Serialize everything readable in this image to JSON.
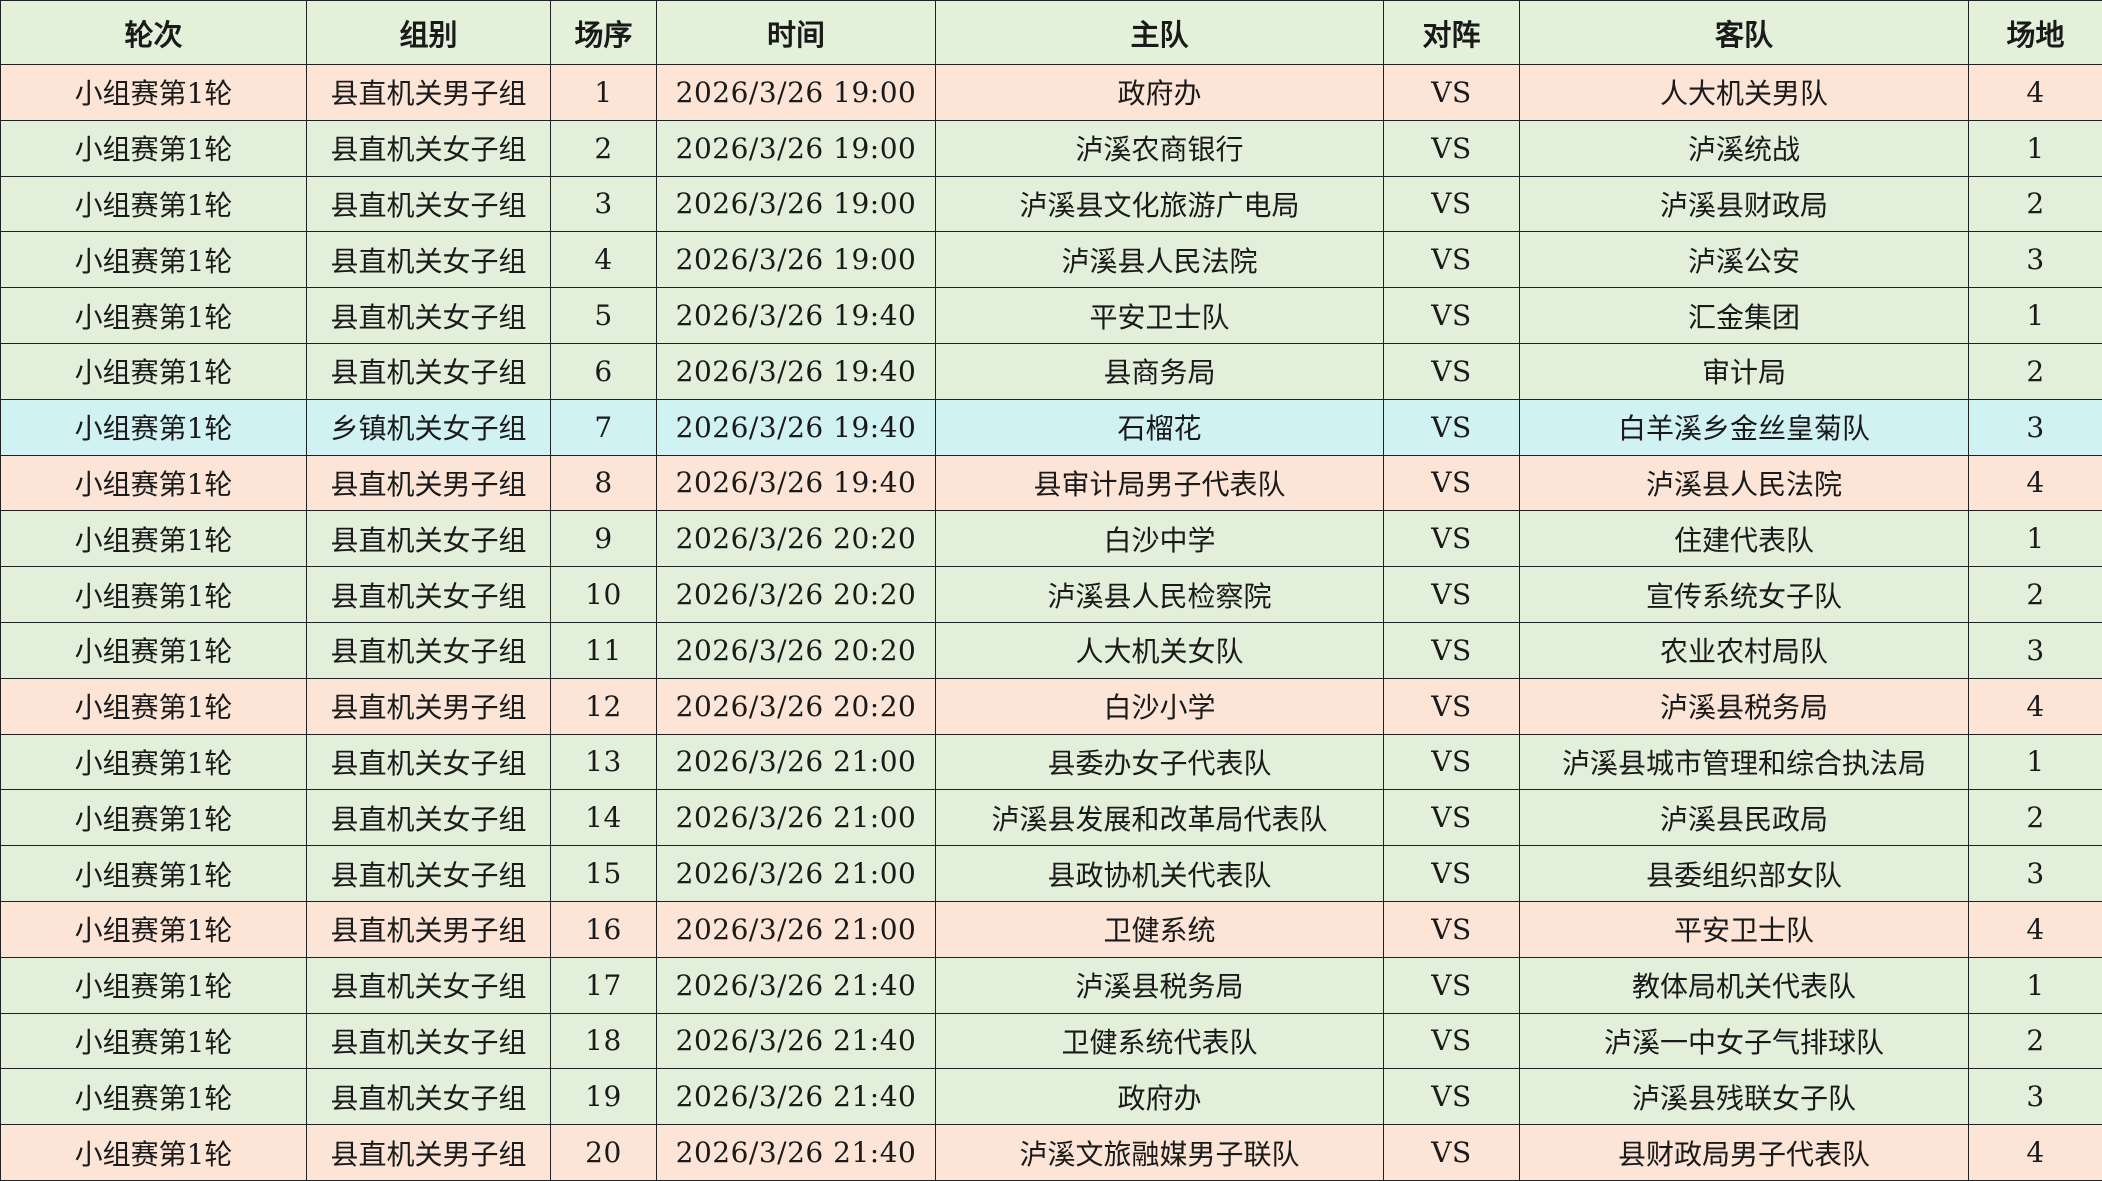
{
  "headers": [
    "轮次",
    "组别",
    "场序",
    "时间",
    "主队",
    "对阵",
    "客队",
    "场地"
  ],
  "group_colors": {
    "县直机关男子组": "#fce4d6",
    "县直机关女子组": "#e2efda",
    "乡镇机关女子组": "#d1f2f2",
    "header": "#e3f0da"
  },
  "rows": [
    {
      "round": "小组赛第1轮",
      "group": "县直机关男子组",
      "seq": "1",
      "time": "2026/3/26 19:00",
      "home": "政府办",
      "vs": "VS",
      "away": "人大机关男队",
      "venue": "4"
    },
    {
      "round": "小组赛第1轮",
      "group": "县直机关女子组",
      "seq": "2",
      "time": "2026/3/26 19:00",
      "home": "泸溪农商银行",
      "vs": "VS",
      "away": "泸溪统战",
      "venue": "1"
    },
    {
      "round": "小组赛第1轮",
      "group": "县直机关女子组",
      "seq": "3",
      "time": "2026/3/26 19:00",
      "home": "泸溪县文化旅游广电局",
      "vs": "VS",
      "away": "泸溪县财政局",
      "venue": "2"
    },
    {
      "round": "小组赛第1轮",
      "group": "县直机关女子组",
      "seq": "4",
      "time": "2026/3/26 19:00",
      "home": "泸溪县人民法院",
      "vs": "VS",
      "away": "泸溪公安",
      "venue": "3"
    },
    {
      "round": "小组赛第1轮",
      "group": "县直机关女子组",
      "seq": "5",
      "time": "2026/3/26 19:40",
      "home": "平安卫士队",
      "vs": "VS",
      "away": "汇金集团",
      "venue": "1"
    },
    {
      "round": "小组赛第1轮",
      "group": "县直机关女子组",
      "seq": "6",
      "time": "2026/3/26 19:40",
      "home": "县商务局",
      "vs": "VS",
      "away": "审计局",
      "venue": "2"
    },
    {
      "round": "小组赛第1轮",
      "group": "乡镇机关女子组",
      "seq": "7",
      "time": "2026/3/26 19:40",
      "home": "石榴花",
      "vs": "VS",
      "away": "白羊溪乡金丝皇菊队",
      "venue": "3"
    },
    {
      "round": "小组赛第1轮",
      "group": "县直机关男子组",
      "seq": "8",
      "time": "2026/3/26 19:40",
      "home": "县审计局男子代表队",
      "vs": "VS",
      "away": "泸溪县人民法院",
      "venue": "4"
    },
    {
      "round": "小组赛第1轮",
      "group": "县直机关女子组",
      "seq": "9",
      "time": "2026/3/26 20:20",
      "home": "白沙中学",
      "vs": "VS",
      "away": "住建代表队",
      "venue": "1"
    },
    {
      "round": "小组赛第1轮",
      "group": "县直机关女子组",
      "seq": "10",
      "time": "2026/3/26 20:20",
      "home": "泸溪县人民检察院",
      "vs": "VS",
      "away": "宣传系统女子队",
      "venue": "2"
    },
    {
      "round": "小组赛第1轮",
      "group": "县直机关女子组",
      "seq": "11",
      "time": "2026/3/26 20:20",
      "home": "人大机关女队",
      "vs": "VS",
      "away": "农业农村局队",
      "venue": "3"
    },
    {
      "round": "小组赛第1轮",
      "group": "县直机关男子组",
      "seq": "12",
      "time": "2026/3/26 20:20",
      "home": "白沙小学",
      "vs": "VS",
      "away": "泸溪县税务局",
      "venue": "4"
    },
    {
      "round": "小组赛第1轮",
      "group": "县直机关女子组",
      "seq": "13",
      "time": "2026/3/26 21:00",
      "home": "县委办女子代表队",
      "vs": "VS",
      "away": "泸溪县城市管理和综合执法局",
      "venue": "1"
    },
    {
      "round": "小组赛第1轮",
      "group": "县直机关女子组",
      "seq": "14",
      "time": "2026/3/26 21:00",
      "home": "泸溪县发展和改革局代表队",
      "vs": "VS",
      "away": "泸溪县民政局",
      "venue": "2"
    },
    {
      "round": "小组赛第1轮",
      "group": "县直机关女子组",
      "seq": "15",
      "time": "2026/3/26 21:00",
      "home": "县政协机关代表队",
      "vs": "VS",
      "away": "县委组织部女队",
      "venue": "3"
    },
    {
      "round": "小组赛第1轮",
      "group": "县直机关男子组",
      "seq": "16",
      "time": "2026/3/26 21:00",
      "home": "卫健系统",
      "vs": "VS",
      "away": "平安卫士队",
      "venue": "4"
    },
    {
      "round": "小组赛第1轮",
      "group": "县直机关女子组",
      "seq": "17",
      "time": "2026/3/26 21:40",
      "home": "泸溪县税务局",
      "vs": "VS",
      "away": "教体局机关代表队",
      "venue": "1"
    },
    {
      "round": "小组赛第1轮",
      "group": "县直机关女子组",
      "seq": "18",
      "time": "2026/3/26 21:40",
      "home": "卫健系统代表队",
      "vs": "VS",
      "away": "泸溪一中女子气排球队",
      "venue": "2"
    },
    {
      "round": "小组赛第1轮",
      "group": "县直机关女子组",
      "seq": "19",
      "time": "2026/3/26 21:40",
      "home": "政府办",
      "vs": "VS",
      "away": "泸溪县残联女子队",
      "venue": "3"
    },
    {
      "round": "小组赛第1轮",
      "group": "县直机关男子组",
      "seq": "20",
      "time": "2026/3/26 21:40",
      "home": "泸溪文旅融媒男子联队",
      "vs": "VS",
      "away": "县财政局男子代表队",
      "venue": "4"
    }
  ]
}
